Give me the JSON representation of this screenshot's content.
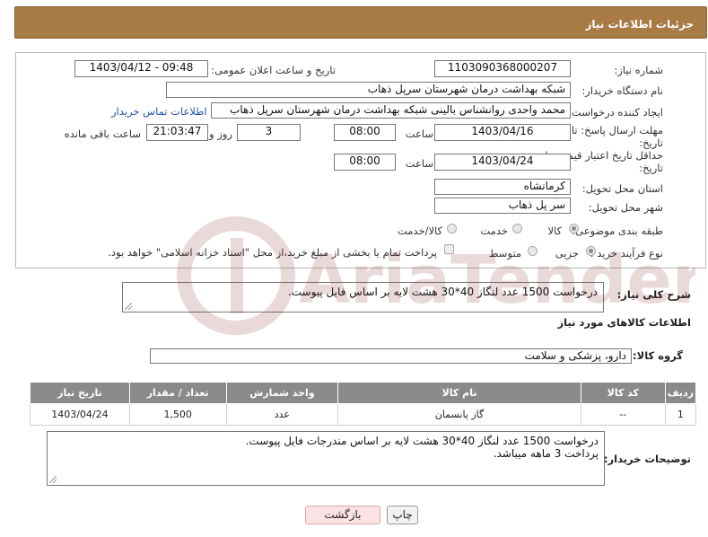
{
  "header": {
    "title": "جزئیات اطلاعات نیاز"
  },
  "fields": {
    "need_number_label": "شماره نیاز:",
    "need_number": "1103090368000207",
    "announce_label": "تاریخ و ساعت اعلان عمومی:",
    "announce_value": "1403/04/12 - 09:48",
    "buyer_org_label": "نام دستگاه خریدار:",
    "buyer_org": "شبکه بهداشت درمان شهرستان سرپل ذهاب",
    "requester_label": "ایجاد کننده درخواست:",
    "requester": "محمد واحدی روانشناس بالینی شبکه بهداشت درمان شهرستان سرپل ذهاب",
    "buyer_contact_link": "اطلاعات تماس خریدار",
    "deadline_label_1": "مهلت ارسال پاسخ: تا",
    "deadline_label_2": "تاریخ:",
    "deadline_date": "1403/04/16",
    "time_label": "ساعت",
    "deadline_time": "08:00",
    "days_value": "3",
    "days_label": "روز و",
    "remaining_time": "21:03:47",
    "remaining_label": "ساعت باقی مانده",
    "validity_label_1": "حداقل تاریخ اعتبار قیمت: تا",
    "validity_label_2": "تاریخ:",
    "validity_date": "1403/04/24",
    "validity_time_label": "ساعت",
    "validity_time": "08:00",
    "province_label": "استان محل تحویل:",
    "province": "کرمانشاه",
    "city_label": "شهر محل تحویل:",
    "city": "سر پل ذهاب",
    "category_label": "طبقه بندی موضوعی:",
    "category_options": [
      "کالا",
      "خدمت",
      "کالا/خدمت"
    ],
    "category_selected": "کالا",
    "process_label": "نوع فرآیند خرید :",
    "process_options": [
      "جزیی",
      "متوسط"
    ],
    "process_selected": "جزیی",
    "payment_note": "پرداخت تمام یا بخشی از مبلغ خرید،از محل \"اسناد خزانه اسلامی\" خواهد بود."
  },
  "description": {
    "label": "شرح کلی نیاز:",
    "text": "درخواست 1500 عدد لنگاز 40*30 هشت لایه بر اساس فایل پیوست."
  },
  "goods_section": {
    "title": "اطلاعات کالاهای مورد نیاز",
    "group_label": "گروه کالا:",
    "group_value": "دارو، پزشکی و سلامت"
  },
  "table": {
    "headers": [
      "ردیف",
      "کد کالا",
      "نام کالا",
      "واحد شمارش",
      "تعداد / مقدار",
      "تاریخ نیاز"
    ],
    "rows": [
      [
        "1",
        "--",
        "گاز پانسمان",
        "عدد",
        "1,500",
        "1403/04/24"
      ]
    ]
  },
  "buyer_notes": {
    "label": "توضیحات خریدار:",
    "line1": "درخواست 1500 عدد لنگاز 40*30 هشت لایه بر  اساس مندرجات فایل  پیوست.",
    "line2": "پرداخت 3 ماهه میباشد."
  },
  "buttons": {
    "print": "چاپ",
    "back": "بازگشت"
  },
  "watermark": {
    "text": "AriaTender.neT"
  },
  "colors": {
    "header_bg": "#a87a44",
    "table_header_bg": "#8a8a8a",
    "back_button_bg": "#fbe3e3",
    "link": "#2255aa"
  }
}
